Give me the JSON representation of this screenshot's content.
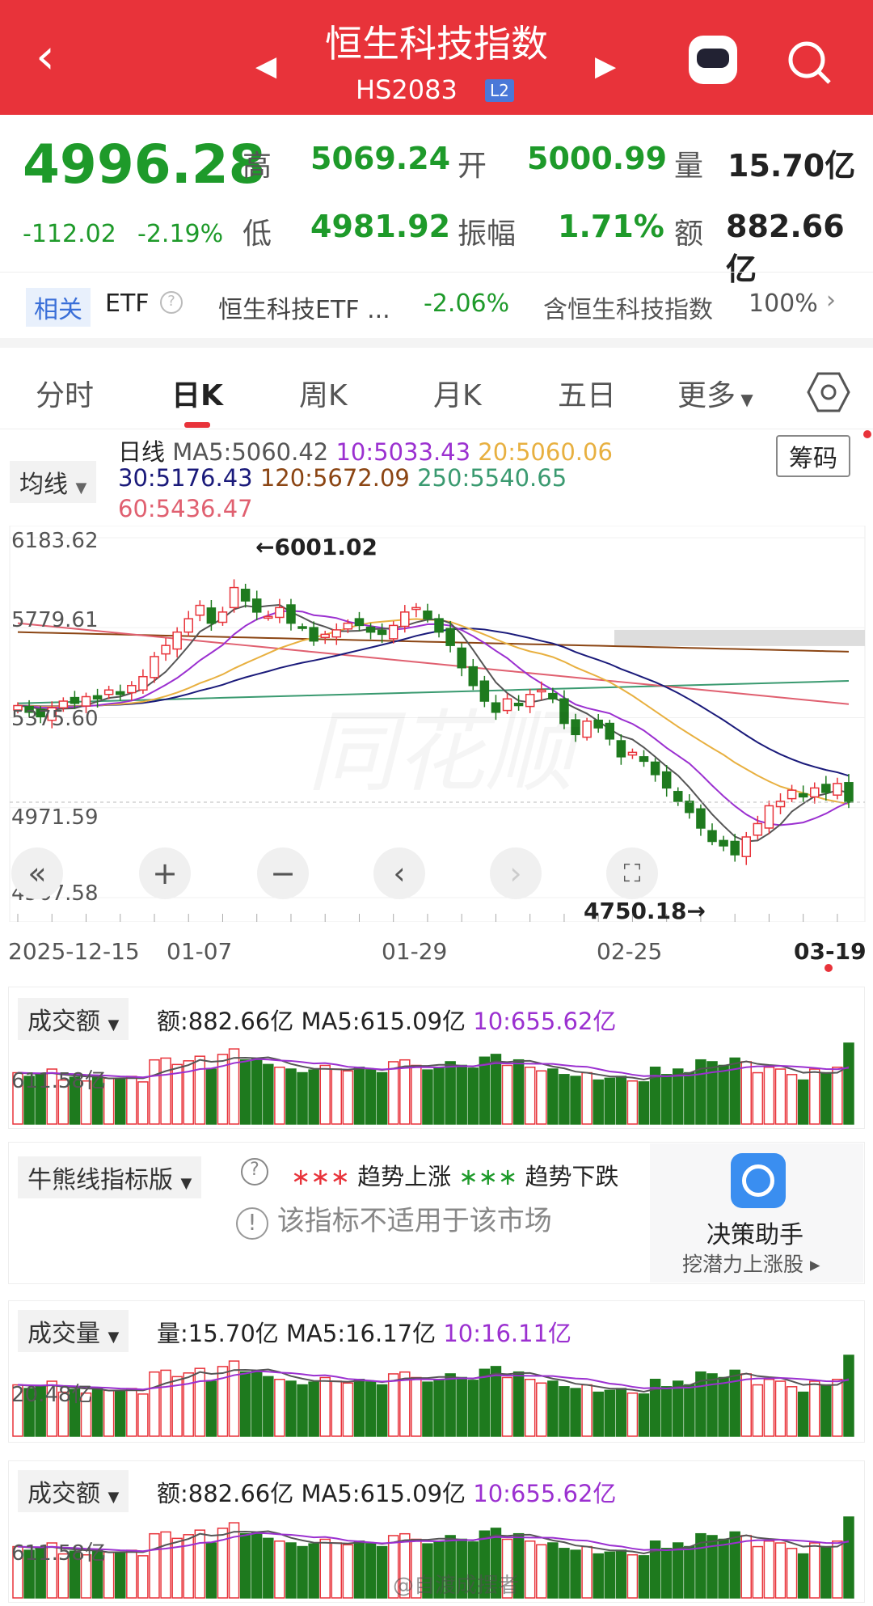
{
  "header": {
    "title": "恒生科技指数",
    "code": "HS2083",
    "level": "L2"
  },
  "quote": {
    "price": "4996.28",
    "change": "-112.02",
    "change_pct": "-2.19%",
    "high_label": "高",
    "high": "5069.24",
    "open_label": "开",
    "open": "5000.99",
    "vol_label": "量",
    "vol": "15.70亿",
    "low_label": "低",
    "low": "4981.92",
    "amp_label": "振幅",
    "amp": "1.71%",
    "amt_label": "额",
    "amt": "882.66亿"
  },
  "etf": {
    "tag": "相关",
    "etf": "ETF",
    "name": "恒生科技ETF ...",
    "pct": "-2.06%",
    "desc": "含恒生科技指数",
    "ratio": "100%"
  },
  "tabs": [
    "分时",
    "日K",
    "周K",
    "月K",
    "五日",
    "更多"
  ],
  "ma": {
    "selector": "均线",
    "title": "日线",
    "ma5": "MA5:5060.42",
    "ma10": "10:5033.43",
    "ma20": "20:5060.06",
    "ma30": "30:5176.43",
    "ma120": "120:5672.09",
    "ma250": "250:5540.65",
    "ma60": "60:5436.47",
    "chip_button": "筹码"
  },
  "colors": {
    "up": "#e8333a",
    "down": "#1e7a1e",
    "ma5": "#555555",
    "ma10": "#9b30d0",
    "ma20": "#e8b040",
    "ma30": "#1a1a7a",
    "ma60": "#e06070",
    "ma120": "#8b4513",
    "ma250": "#3a9a70"
  },
  "chart_data": {
    "type": "candlestick",
    "y_ticks": [
      "6183.62",
      "5779.61",
      "5375.60",
      "4971.59",
      "4567.58"
    ],
    "ylim": [
      4567.58,
      6183.62
    ],
    "x_ticks": [
      "2025-12-15",
      "01-07",
      "01-29",
      "02-25",
      "03-19"
    ],
    "annotations": {
      "high": "←6001.02",
      "low": "4750.18→"
    },
    "closes": [
      5430,
      5400,
      5380,
      5420,
      5450,
      5440,
      5470,
      5460,
      5500,
      5480,
      5520,
      5560,
      5650,
      5700,
      5760,
      5820,
      5880,
      5800,
      5850,
      5960,
      5900,
      5850,
      5830,
      5870,
      5800,
      5780,
      5720,
      5750,
      5770,
      5800,
      5790,
      5760,
      5750,
      5790,
      5850,
      5870,
      5820,
      5760,
      5700,
      5600,
      5520,
      5450,
      5400,
      5460,
      5430,
      5480,
      5500,
      5460,
      5350,
      5300,
      5360,
      5330,
      5280,
      5200,
      5220,
      5180,
      5120,
      5060,
      5000,
      4950,
      4880,
      4820,
      4800,
      4760,
      4840,
      4900,
      4980,
      5000,
      5050,
      5020,
      5060,
      5040,
      5080,
      4996
    ],
    "ma60": [
      5800,
      5436.47
    ],
    "ma120": [
      5760,
      5672.09
    ],
    "ma250": [
      5440,
      5540.65
    ],
    "turnover": [
      560,
      520,
      540,
      600,
      480,
      510,
      470,
      530,
      500,
      490,
      520,
      460,
      700,
      720,
      650,
      690,
      740,
      600,
      760,
      820,
      700,
      710,
      650,
      620,
      600,
      560,
      590,
      640,
      600,
      580,
      620,
      590,
      560,
      680,
      700,
      640,
      590,
      620,
      680,
      640,
      610,
      730,
      760,
      640,
      700,
      620,
      580,
      600,
      540,
      520,
      560,
      480,
      500,
      520,
      470,
      460,
      620,
      540,
      600,
      560,
      700,
      680,
      640,
      720,
      680,
      560,
      620,
      600,
      540,
      480,
      600,
      560,
      620,
      882.66
    ]
  },
  "turnover_panel": {
    "title": "成交额",
    "amt": "额:882.66亿",
    "ma5": "MA5:615.09亿",
    "ma10": "10:655.62亿",
    "ylab": "611.58亿"
  },
  "bull": {
    "title": "牛熊线指标版",
    "up": "趋势上涨",
    "down": "趋势下跌",
    "notice": "该指标不适用于该市场",
    "assist": "决策助手",
    "assist_sub": "挖潜力上涨股"
  },
  "volume_panel": {
    "title": "成交量",
    "vol": "量:15.70亿",
    "ma5": "MA5:16.17亿",
    "ma10": "10:16.11亿",
    "ylab": "20.48亿"
  },
  "watermark": "@自渡成摆者"
}
